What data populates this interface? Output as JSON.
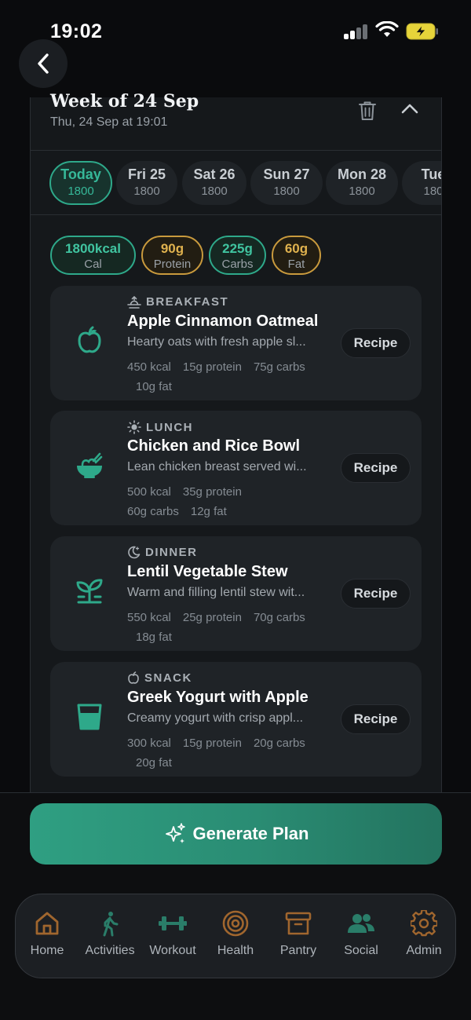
{
  "status_bar": {
    "time": "19:02"
  },
  "header": {
    "title": "Week of 24 Sep",
    "subtitle": "Thu, 24 Sep at 19:01"
  },
  "days": [
    {
      "name": "Today",
      "value": "1800",
      "active": true
    },
    {
      "name": "Fri 25",
      "value": "1800"
    },
    {
      "name": "Sat 26",
      "value": "1800"
    },
    {
      "name": "Sun 27",
      "value": "1800"
    },
    {
      "name": "Mon 28",
      "value": "1800"
    },
    {
      "name": "Tue",
      "value": "180"
    }
  ],
  "macros": [
    {
      "value": "1800kcal",
      "label": "Cal",
      "color": "#40c4a0"
    },
    {
      "value": "90g",
      "label": "Protein",
      "color": "#e0b24e"
    },
    {
      "value": "225g",
      "label": "Carbs",
      "color": "#40c4a0"
    },
    {
      "value": "60g",
      "label": "Fat",
      "color": "#e0b24e"
    }
  ],
  "meals": [
    {
      "type": "BREAKFAST",
      "type_icon": "sunrise-icon",
      "icon": "apple-icon",
      "name": "Apple Cinnamon Oatmeal",
      "description": "Hearty oats with fresh apple sl...",
      "stats": [
        "450 kcal",
        "15g protein",
        "75g carbs",
        "10g fat"
      ],
      "button": "Recipe"
    },
    {
      "type": "LUNCH",
      "type_icon": "sun-icon",
      "icon": "bowl-icon",
      "name": "Chicken and Rice Bowl",
      "description": "Lean chicken breast served wi...",
      "stats": [
        "500 kcal",
        "35g protein",
        "60g carbs",
        "12g fat"
      ],
      "button": "Recipe"
    },
    {
      "type": "DINNER",
      "type_icon": "moon-icon",
      "icon": "sprout-icon",
      "name": "Lentil Vegetable Stew",
      "description": "Warm and filling lentil stew wit...",
      "stats": [
        "550 kcal",
        "25g protein",
        "70g carbs",
        "18g fat"
      ],
      "button": "Recipe"
    },
    {
      "type": "SNACK",
      "type_icon": "apple-icon",
      "icon": "cup-icon",
      "name": "Greek Yogurt with Apple",
      "description": "Creamy yogurt with crisp appl...",
      "stats": [
        "300 kcal",
        "15g protein",
        "20g carbs",
        "20g fat"
      ],
      "button": "Recipe"
    }
  ],
  "generate_button": {
    "label": "Generate Plan",
    "icon": "sparkles-icon"
  },
  "tabs": [
    {
      "label": "Home",
      "icon": "home-icon"
    },
    {
      "label": "Activities",
      "icon": "walking-icon"
    },
    {
      "label": "Workout",
      "icon": "dumbbell-icon"
    },
    {
      "label": "Health",
      "icon": "target-icon"
    },
    {
      "label": "Pantry",
      "icon": "archive-icon"
    },
    {
      "label": "Social",
      "icon": "users-icon"
    },
    {
      "label": "Admin",
      "icon": "gear-icon"
    }
  ],
  "colors": {
    "accent": "#2ea98a",
    "gold": "#c99a3d",
    "tab_icon": "#a0662e",
    "background": "#0a0b0d"
  }
}
